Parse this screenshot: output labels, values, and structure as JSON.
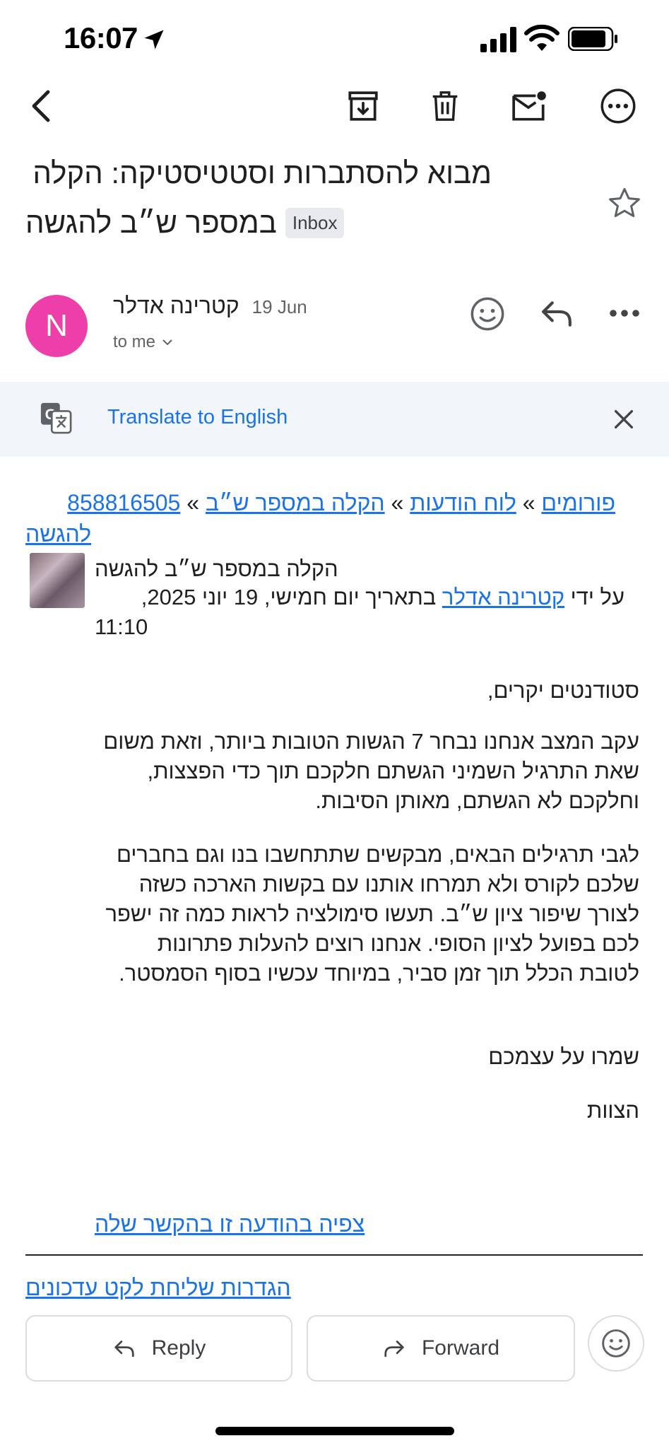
{
  "status_bar": {
    "time": "16:07"
  },
  "subject": {
    "line1": "מבוא להסתברות וסטטיסטיקה: הקלה",
    "line2": "במספר ש״ב להגשה",
    "label": "Inbox"
  },
  "sender": {
    "initial": "N",
    "name": "קטרינה אדלר",
    "date": "19 Jun",
    "to": "to me"
  },
  "translate": {
    "label": "Translate to English"
  },
  "body": {
    "breadcrumb": {
      "forums": "פורומים",
      "sep1": "»",
      "board": "לוח הודעות",
      "sep2": "»",
      "thread": "הקלה במספר ש״ב",
      "sep3": "»",
      "id": "858816505",
      "suffix": "להגשה"
    },
    "post": {
      "title": "הקלה במספר ש״ב להגשה",
      "by_prefix": "על ידי",
      "author": "קטרינה אדלר",
      "date_text": "בתאריך יום חמישי, 19 יוני 2025,",
      "time": "11:10"
    },
    "greeting": "סטודנטים יקרים,",
    "para1": "עקב המצב אנחנו נבחר 7 הגשות הטובות ביותר, וזאת משום שאת התרגיל השמיני הגשתם חלקכם תוך כדי הפצצות, וחלקכם לא הגשתם, מאותן הסיבות.",
    "para2": "לגבי תרגילים הבאים, מבקשים שתתחשבו בנו וגם בחברים שלכם לקורס ולא תמרחו אותנו עם בקשות הארכה כשזה לצורך שיפור ציון ש״ב. תעשו סימולציה לראות כמה זה ישפר לכם בפועל לציון הסופי. אנחנו רוצים להעלות פתרונות לטובת הכלל תוך זמן סביר, במיוחד עכשיו בסוף הסמסטר.",
    "closing": "שמרו על עצמכם",
    "signature": "הצוות",
    "view_link": "צפיה בהודעה זו בהקשר שלה",
    "settings_link": "הגדרות שליחת לקט עדכונים"
  },
  "actions": {
    "reply": "Reply",
    "forward": "Forward"
  },
  "colors": {
    "accent": "#1a73e8",
    "avatar": "#ee3ea9",
    "translate_bg": "#f2f6fb"
  },
  "icons": [
    "back-arrow-icon",
    "archive-icon",
    "trash-icon",
    "mark-unread-icon",
    "more-options-icon",
    "star-icon",
    "emoji-react-icon",
    "reply-icon",
    "more-horizontal-icon",
    "translate-icon",
    "close-icon",
    "forward-icon"
  ]
}
